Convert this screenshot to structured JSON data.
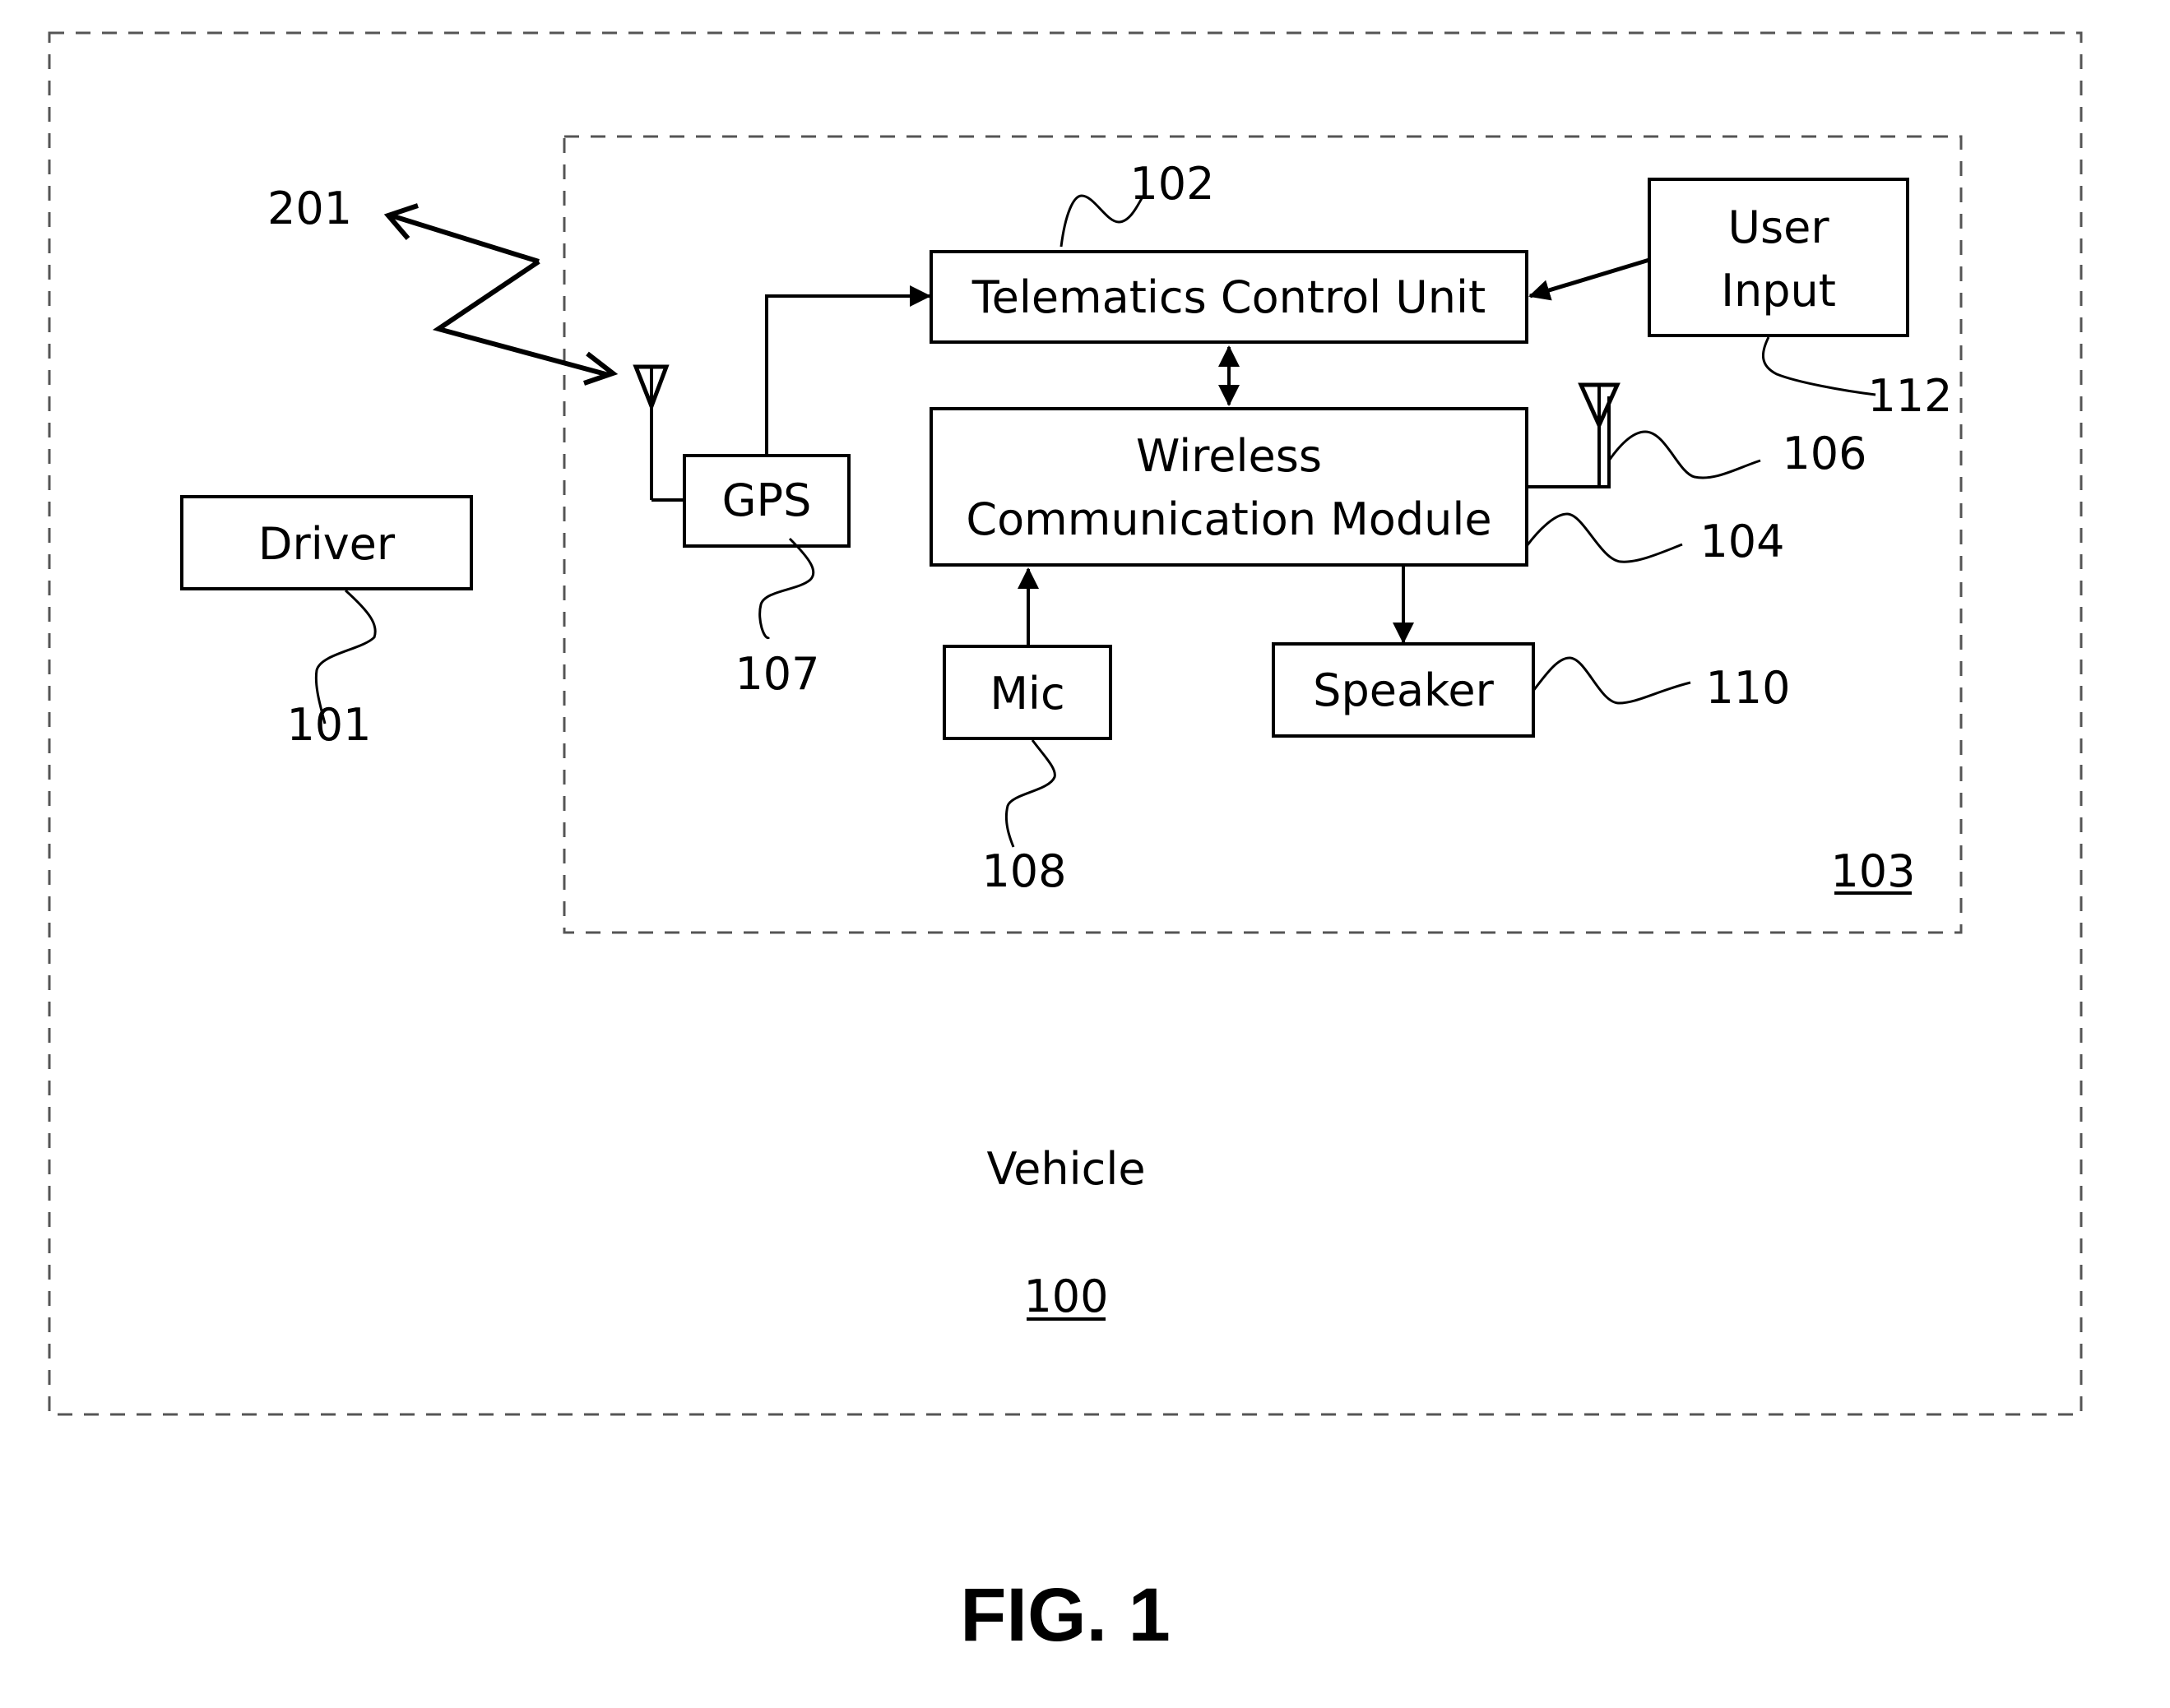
{
  "figure": {
    "caption": "FIG. 1",
    "vehicle": {
      "label": "Vehicle",
      "ref": "100"
    },
    "system": {
      "ref": "103"
    },
    "signal": {
      "ref": "201"
    },
    "components": {
      "driver": {
        "label": "Driver",
        "ref": "101"
      },
      "tcu": {
        "label": "Telematics Control Unit",
        "ref": "102"
      },
      "wcm": {
        "label_line1": "Wireless",
        "label_line2": "Communication Module",
        "ref": "104"
      },
      "antenna": {
        "ref": "106"
      },
      "gps": {
        "label": "GPS",
        "ref": "107"
      },
      "mic": {
        "label": "Mic",
        "ref": "108"
      },
      "speaker": {
        "label": "Speaker",
        "ref": "110"
      },
      "user_input": {
        "label_line1": "User",
        "label_line2": "Input",
        "ref": "112"
      }
    },
    "connections": [
      {
        "from": "gps",
        "to": "tcu",
        "direction": "one-way"
      },
      {
        "from": "user_input",
        "to": "tcu",
        "direction": "one-way"
      },
      {
        "from": "tcu",
        "to": "wcm",
        "direction": "two-way"
      },
      {
        "from": "mic",
        "to": "wcm",
        "direction": "one-way"
      },
      {
        "from": "wcm",
        "to": "speaker",
        "direction": "one-way"
      },
      {
        "from": "wcm",
        "to": "antenna",
        "direction": "wired"
      },
      {
        "from": "signal",
        "to": "gps-antenna",
        "direction": "two-way-wireless"
      }
    ]
  }
}
